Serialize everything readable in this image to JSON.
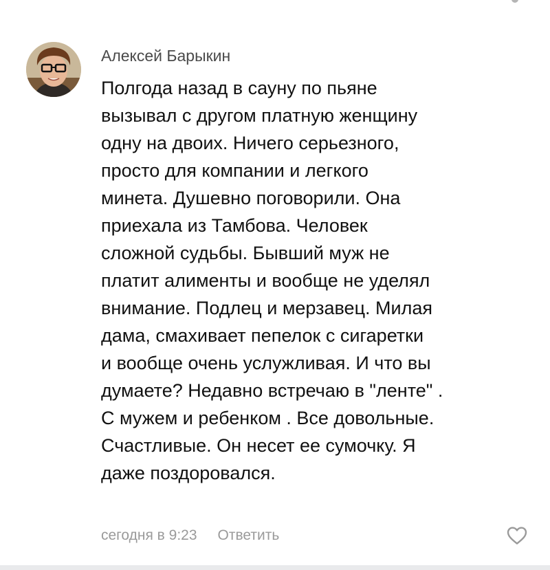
{
  "comment": {
    "author": "Алексей Барыкин",
    "text_lines": [
      "Полгода назад в сауну по пьяне",
      "вызывал с другом платную женщину",
      "одну на двоих. Ничего серьезного,",
      "просто для компании и легкого",
      "минета. Душевно поговорили. Она",
      "приехала из Тамбова. Человек",
      "сложной судьбы. Бывший муж не",
      "платит алименты и вообще не уделял",
      "внимание. Подлец и мерзавец. Милая",
      "дама, смахивает пепелок с сигаретки",
      "и вообще очень услужливая. И что вы",
      "думаете? Недавно встречаю в \"ленте\" .",
      "С мужем и ребенком . Все довольные.",
      "Счастливые. Он несет ее сумочку. Я",
      "даже поздоровался."
    ],
    "timestamp": "сегодня в 9:23",
    "reply_label": "Ответить",
    "like_icon": "heart-outline-icon",
    "avatar_icon": "user-photo-avatar"
  },
  "colors": {
    "author": "#4a4a4a",
    "text": "#111111",
    "meta": "#9a9a9a",
    "divider": "#e9eaec"
  }
}
